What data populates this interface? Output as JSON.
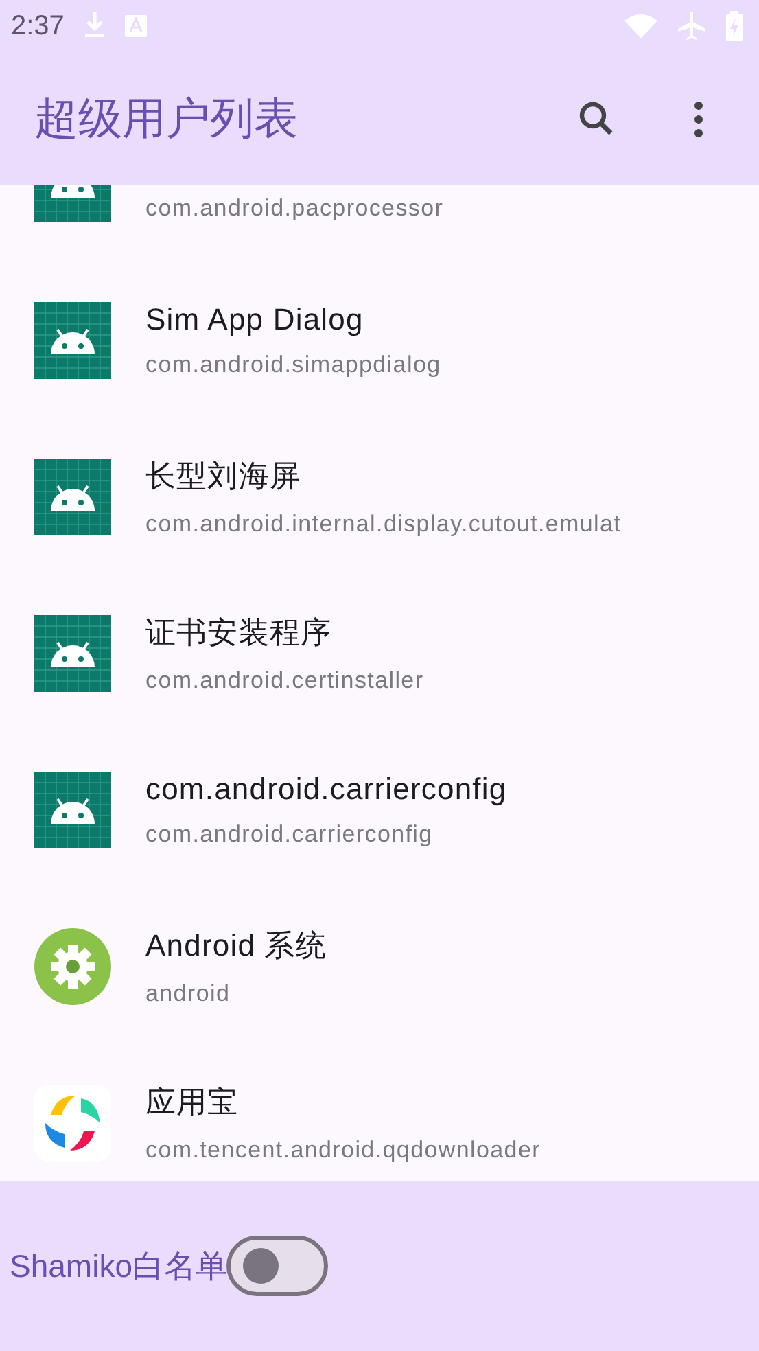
{
  "status_bar": {
    "time": "2:37"
  },
  "app_bar": {
    "title": "超级用户列表"
  },
  "apps": [
    {
      "package": "com.android.pacprocessor",
      "kind": "android"
    },
    {
      "title": "Sim App Dialog",
      "package": "com.android.simappdialog",
      "kind": "android"
    },
    {
      "title": "长型刘海屏",
      "package": "com.android.internal.display.cutout.emulat",
      "kind": "android"
    },
    {
      "title": "证书安装程序",
      "package": "com.android.certinstaller",
      "kind": "android"
    },
    {
      "title": "com.android.carrierconfig",
      "package": "com.android.carrierconfig",
      "kind": "android"
    },
    {
      "title": "Android 系统",
      "package": "android",
      "kind": "settings"
    },
    {
      "title": "应用宝",
      "package": "com.tencent.android.qqdownloader",
      "kind": "colorful"
    }
  ],
  "bottom_bar": {
    "label": "Shamiko白名单",
    "on": false
  }
}
